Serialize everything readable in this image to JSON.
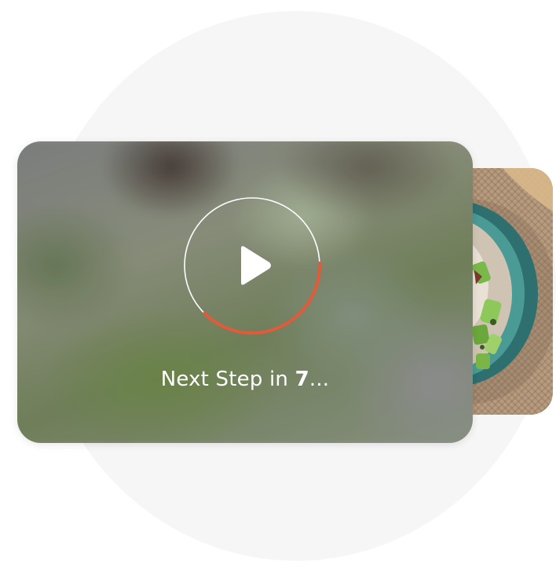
{
  "player": {
    "caption_prefix": "Next Step in ",
    "countdown": "7",
    "caption_suffix": "...",
    "progress": 0.38
  },
  "colors": {
    "accent": "#e25a3a",
    "ring": "#ffffff",
    "background_circle": "#f6f6f6"
  },
  "icons": {
    "play": "play-icon"
  }
}
